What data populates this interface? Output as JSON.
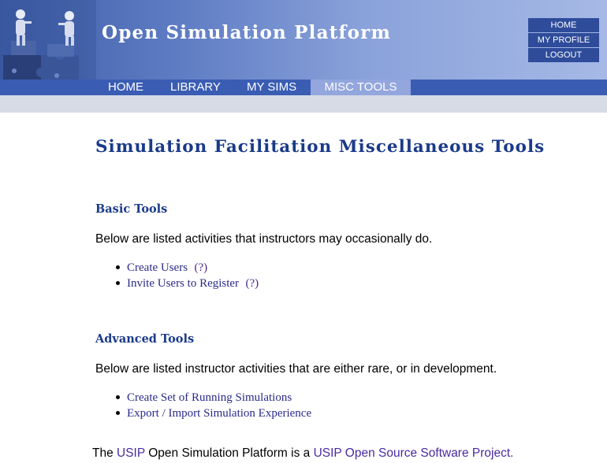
{
  "header": {
    "site_title": "Open Simulation Platform",
    "user_menu": [
      "HOME",
      "MY PROFILE",
      "LOGOUT"
    ]
  },
  "nav": {
    "tabs": [
      {
        "label": "HOME",
        "active": false
      },
      {
        "label": "LIBRARY",
        "active": false
      },
      {
        "label": "MY SIMS",
        "active": false
      },
      {
        "label": "MISC TOOLS",
        "active": true
      }
    ]
  },
  "main": {
    "page_title": "Simulation Facilitation Miscellaneous Tools",
    "sections": [
      {
        "heading": "Basic Tools",
        "description": "Below are listed activities that instructors may occasionally do.",
        "items": [
          {
            "label": "Create Users",
            "help": "(?)"
          },
          {
            "label": "Invite Users to Register",
            "help": "(?)"
          }
        ]
      },
      {
        "heading": "Advanced Tools",
        "description": "Below are listed instructor activities that are either rare, or in development.",
        "items": [
          {
            "label": "Create Set of Running Simulations"
          },
          {
            "label": "Export / Import Simulation Experience"
          }
        ]
      }
    ]
  },
  "footer": {
    "prefix": "The ",
    "usip_link": "USIP",
    "middle": " Open Simulation Platform is a ",
    "project_link": "USIP Open Source Software Project."
  },
  "colors": {
    "header_dark": "#3f5da8",
    "nav_bar": "#3a5cb3",
    "nav_active": "#93a6dd",
    "heading_blue": "#1a3a8a",
    "link_purple": "#4a2aa0"
  }
}
